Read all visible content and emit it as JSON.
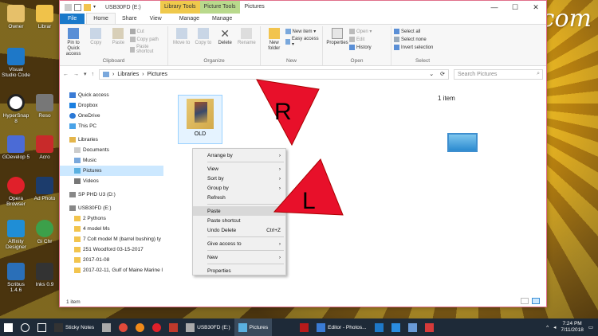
{
  "watermark": "StuckAtHomeMom.com",
  "desktop_icons": [
    "Owner",
    "Librar",
    "Visual Studio Code",
    "HyperSnap 8",
    "Reso",
    "GDevelop 5",
    "Acro",
    "Opera Browser",
    "Ad Photo",
    "Affinity Designer",
    "Gi Chr",
    "Scribus 1.4.6",
    "Inks 0.9"
  ],
  "window": {
    "title": "USB30FD (E:)",
    "ctx_library": "Library Tools",
    "ctx_picture": "Picture Tools",
    "title2": "Pictures",
    "min": "—",
    "max": "☐",
    "close": "✕"
  },
  "ribbon_tabs": {
    "file": "File",
    "home": "Home",
    "share": "Share",
    "view": "View",
    "manage1": "Manage",
    "manage2": "Manage"
  },
  "ribbon": {
    "pin": "Pin to Quick access",
    "copy": "Copy",
    "paste": "Paste",
    "cut": "Cut",
    "copy_path": "Copy path",
    "paste_shortcut": "Paste shortcut",
    "clipboard": "Clipboard",
    "move_to": "Move to",
    "copy_to": "Copy to",
    "delete": "Delete",
    "rename": "Rename",
    "organize": "Organize",
    "new_folder": "New folder",
    "new_item": "New item ▾",
    "easy_access": "Easy access ▾",
    "new": "New",
    "properties": "Properties",
    "open": "Open ▾",
    "edit": "Edit",
    "history": "History",
    "open_group": "Open",
    "select_all": "Select all",
    "select_none": "Select none",
    "invert": "Invert selection",
    "select": "Select"
  },
  "address": {
    "path1": "Libraries",
    "path2": "Pictures",
    "search_placeholder": "Search Pictures"
  },
  "nav": {
    "quick_access": "Quick access",
    "dropbox": "Dropbox",
    "onedrive": "OneDrive",
    "this_pc": "This PC",
    "libraries": "Libraries",
    "documents": "Documents",
    "music": "Music",
    "pictures": "Pictures",
    "videos": "Videos",
    "sp_phd": "SP PHD U3 (D:)",
    "usb": "USB30FD (E:)",
    "folders": [
      "2 Pythons",
      "4 model Ms",
      "7 Colt model M (barrel bushing) ty",
      "251 Woodford 03-15-2017",
      "2017-01-08",
      "2017-02-11, Gulf of Maine Marine l"
    ]
  },
  "content": {
    "folder_name": "OLD",
    "item_count": "1 item"
  },
  "status": {
    "text": "1 item"
  },
  "context_menu": {
    "arrange_by": "Arrange by",
    "view": "View",
    "sort_by": "Sort by",
    "group_by": "Group by",
    "refresh": "Refresh",
    "paste": "Paste",
    "paste_shortcut": "Paste shortcut",
    "undo_delete": "Undo Delete",
    "undo_shortcut": "Ctrl+Z",
    "give_access": "Give access to",
    "new": "New",
    "properties": "Properties"
  },
  "annotations": {
    "r": "R",
    "l": "L"
  },
  "taskbar": {
    "sticky": "Sticky Notes",
    "usb": "USB30FD (E:)",
    "pictures": "Pictures",
    "editor": "Editor - Photos...",
    "time": "7:24 PM",
    "date": "7/11/2018"
  },
  "colors": {
    "accent": "#1979ca",
    "library_tools": "#efc94c",
    "picture_tools": "#b9d98c",
    "arrow": "#e8102a"
  }
}
